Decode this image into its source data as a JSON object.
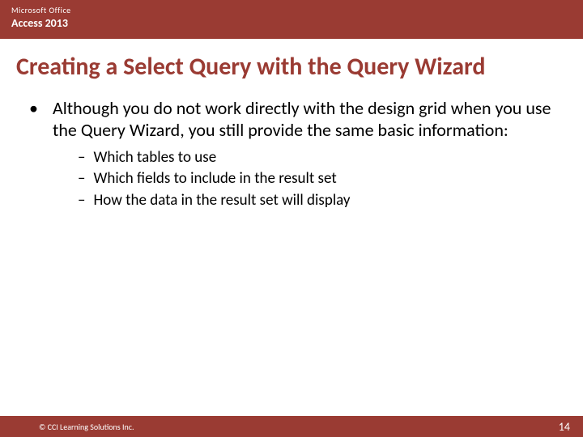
{
  "header": {
    "line1": "Microsoft Office",
    "line2": "Access 2013"
  },
  "title": "Creating a Select Query with the Query Wizard",
  "mainBullet": "Although you do not work directly with the design grid when you use the Query Wizard, you still provide the same basic information:",
  "subBullets": [
    "Which tables to use",
    "Which fields to include in the result set",
    "How the data in the result set will display"
  ],
  "footer": {
    "copyright": "© CCI Learning Solutions Inc.",
    "pageNumber": "14"
  }
}
